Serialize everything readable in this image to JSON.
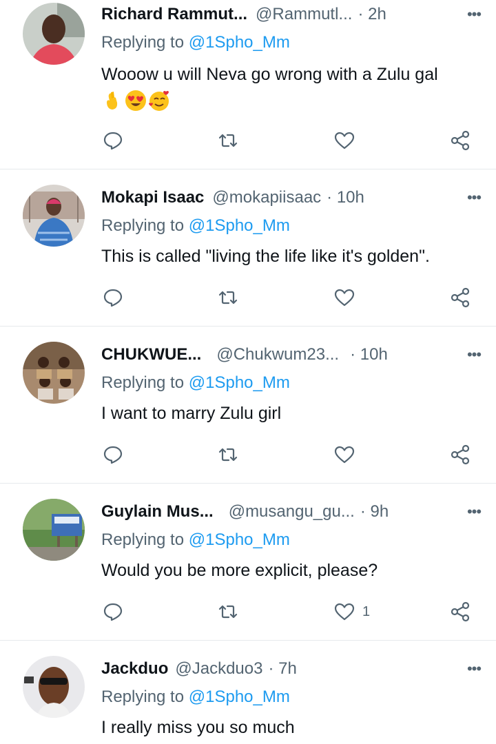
{
  "replying_label": "Replying to",
  "replies": [
    {
      "name": "Richard Rammut...",
      "handle": "@Rammutl...",
      "time": "· 2h",
      "mention": "@1Spho_Mm",
      "text": "Wooow u will Neva go wrong with a Zulu gal",
      "emojis": [
        "crossed-fingers",
        "heart-eyes",
        "smiling-hearts"
      ],
      "likes": ""
    },
    {
      "name": "Mokapi Isaac",
      "handle": "@mokapiisaac",
      "time": "· 10h",
      "mention": "@1Spho_Mm",
      "text": "This is called \"living the life like it's golden\".",
      "likes": ""
    },
    {
      "name": "CHUKWUE...",
      "handle": "@Chukwum23...",
      "time": "· 10h",
      "mention": "@1Spho_Mm",
      "text": "I want to marry Zulu girl",
      "likes": ""
    },
    {
      "name": "Guylain Mus...",
      "handle": "@musangu_gu...",
      "time": "· 9h",
      "mention": "@1Spho_Mm",
      "text": "Would you be more explicit, please?",
      "likes": "1"
    },
    {
      "name": "Jackduo",
      "handle": "@Jackduo3",
      "time": "· 7h",
      "mention": "@1Spho_Mm",
      "text": "I really miss you so much",
      "likes": ""
    }
  ],
  "icons": {
    "reply": "reply-bubble-icon",
    "retweet": "retweet-icon",
    "like": "heart-icon",
    "share": "share-icon",
    "more": "more-dots-icon"
  },
  "colors": {
    "text": "#0f1419",
    "secondary": "#536471",
    "mention": "#1d9bf0",
    "divider": "#e6e9ec"
  }
}
